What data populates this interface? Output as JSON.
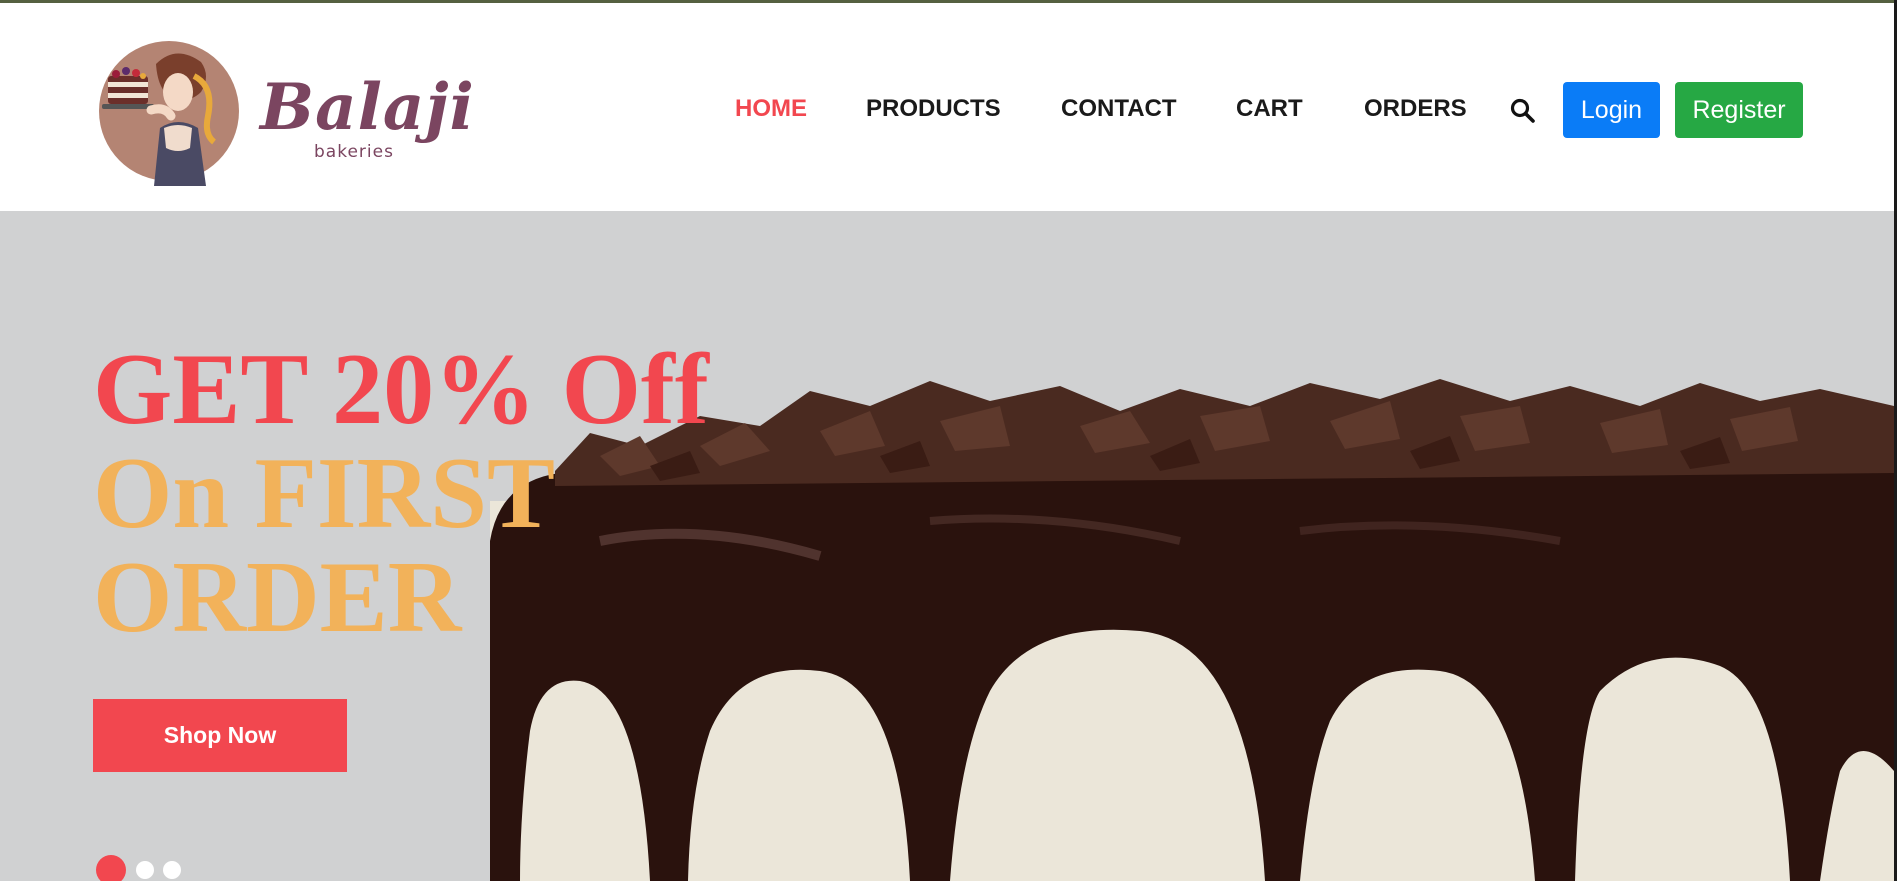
{
  "brand": {
    "name": "Balaji",
    "tagline": "bakeries"
  },
  "nav": {
    "items": [
      {
        "label": "HOME",
        "active": true
      },
      {
        "label": "PRODUCTS",
        "active": false
      },
      {
        "label": "CONTACT",
        "active": false
      },
      {
        "label": "CART",
        "active": false
      },
      {
        "label": "ORDERS",
        "active": false
      }
    ]
  },
  "auth": {
    "login_label": "Login",
    "register_label": "Register"
  },
  "hero": {
    "headline_line1": "GET 20% Off",
    "headline_line2": "On FIRST",
    "headline_line3": "ORDER",
    "cta_label": "Shop Now",
    "slides_total": 3,
    "active_slide": 1
  },
  "colors": {
    "accent_red": "#f2474f",
    "accent_orange": "#f2b25a",
    "login_blue": "#0a7cf7",
    "register_green": "#26a844",
    "brand_plum": "#7b4560"
  },
  "icons": {
    "search": "search-icon"
  }
}
